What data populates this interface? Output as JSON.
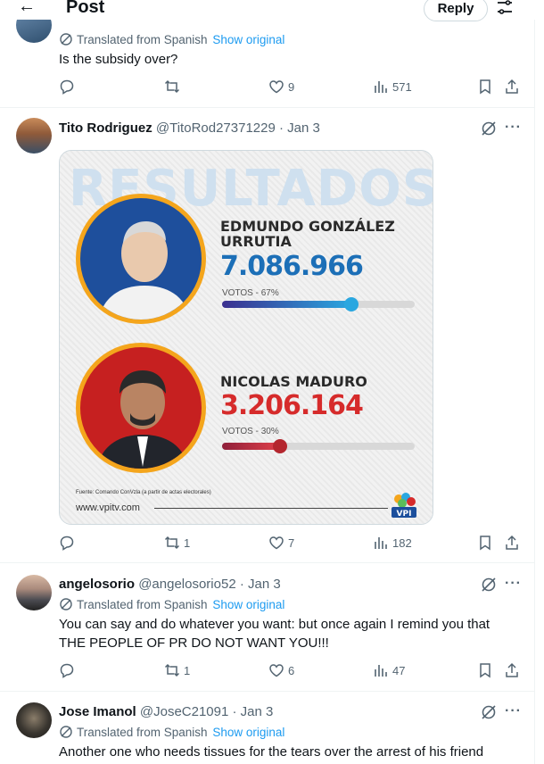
{
  "header": {
    "title": "Post",
    "reply_label": "Reply"
  },
  "tweets": [
    {
      "translated_label": "Translated from Spanish",
      "show_original": "Show original",
      "text": "Is the subsidy over?",
      "replies": "",
      "retweets": "",
      "likes": "9",
      "views": "571"
    },
    {
      "name": "Tito Rodriguez",
      "handle": "@TitoRod27371229",
      "date": "· Jan 3",
      "replies": "",
      "retweets": "1",
      "likes": "7",
      "views": "182",
      "card": {
        "title": "RESULTADOS",
        "candidates": [
          {
            "name_line1": "EDMUNDO GONZÁLEZ",
            "name_line2": "URRUTIA",
            "votes": "7.086.966",
            "pct_label": "VOTOS - 67%",
            "pct": 0.67,
            "color": "#1c6fb7"
          },
          {
            "name_line1": "NICOLAS MADURO",
            "name_line2": "",
            "votes": "3.206.164",
            "pct_label": "VOTOS - 30%",
            "pct": 0.3,
            "color": "#d62b2b"
          }
        ],
        "source": "Fuente: Comando ConVzla (a partir de actas electorales)",
        "site": "www.vpitv.com",
        "logo_text": "VPI"
      }
    },
    {
      "name": "angelosorio",
      "handle": "@angelosorio52",
      "date": "· Jan 3",
      "translated_label": "Translated from Spanish",
      "show_original": "Show original",
      "text_line1": "You can say and do whatever you want: but once again I remind you that",
      "text_line2": "THE PEOPLE OF PR DO NOT WANT YOU!!!",
      "replies": "",
      "retweets": "1",
      "likes": "6",
      "views": "47"
    },
    {
      "name": "Jose Imanol",
      "handle": "@JoseC21091",
      "date": "· Jan 3",
      "translated_label": "Translated from Spanish",
      "show_original": "Show original",
      "text": "Another one who needs tissues for the tears over the arrest of his friend"
    }
  ],
  "more_label": "···",
  "icons": {
    "back": "arrow-left-icon",
    "tune": "sliders-icon",
    "reply": "comment-icon",
    "retweet": "retweet-icon",
    "like": "heart-icon",
    "views": "bar-chart-icon",
    "bookmark": "bookmark-icon",
    "share": "share-icon",
    "grok": "grok-icon"
  }
}
